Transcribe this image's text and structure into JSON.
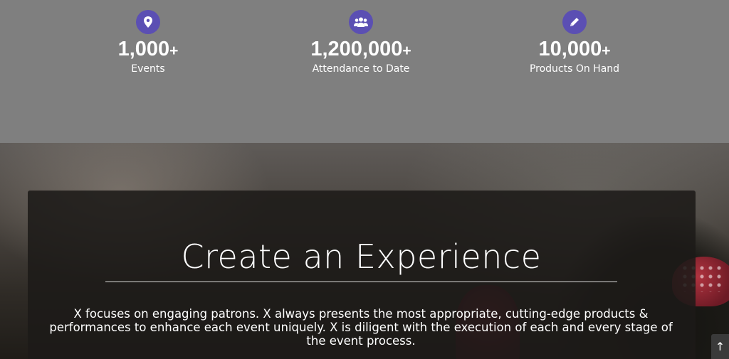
{
  "stats": [
    {
      "icon": "map-pin-icon",
      "number": "1,000",
      "suffix": "+",
      "label": "Events"
    },
    {
      "icon": "group-icon",
      "number": "1,200,000",
      "suffix": "+",
      "label": "Attendance to Date"
    },
    {
      "icon": "pencil-icon",
      "number": "10,000",
      "suffix": "+",
      "label": "Products On Hand"
    }
  ],
  "experience": {
    "heading": "Create an Experience",
    "description": "X focuses on engaging patrons. X always presents the most appropriate, cutting-edge products & performances to enhance each event uniquely. X is diligent with the execution of each and every stage of the event process."
  },
  "scroll_top": {
    "icon": "arrow-up-icon",
    "glyph": "↑"
  },
  "colors": {
    "accent": "#5b4fb3",
    "band": "#7f7f7f"
  }
}
